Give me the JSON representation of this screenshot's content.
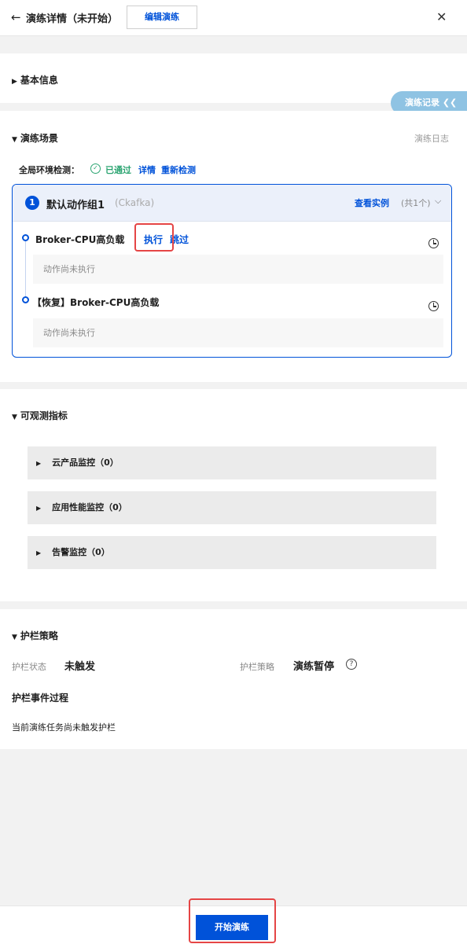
{
  "header": {
    "back_icon": "arrow-left-icon",
    "title": "演练详情（未开始）",
    "edit_label": "编辑演练",
    "close_icon": "close-icon"
  },
  "basic_info": {
    "title": "基本信息"
  },
  "record_tab": {
    "label": "演练记录 ❮❮"
  },
  "scene": {
    "title": "演练场景",
    "log_link": "演练日志",
    "env_check_label": "全局环境检测：",
    "env_check_status": "已通过",
    "env_check_detail": "详情",
    "env_check_recheck": "重新检测",
    "group": {
      "index": "1",
      "name": "默认动作组1",
      "subtitle": "(Ckafka)",
      "view_instances": "查看实例",
      "instance_count": "(共1个)",
      "actions": [
        {
          "name": "Broker-CPU高负载",
          "execute_label": "执行",
          "skip_label": "跳过",
          "status": "动作尚未执行"
        },
        {
          "name": "【恢复】Broker-CPU高负载",
          "status": "动作尚未执行"
        }
      ]
    }
  },
  "metrics": {
    "title": "可观测指标",
    "rows": [
      {
        "label": "云产品监控（0）"
      },
      {
        "label": "应用性能监控（0）"
      },
      {
        "label": "告警监控（0）"
      }
    ]
  },
  "guard": {
    "title": "护栏策略",
    "status_key": "护栏状态",
    "status_value": "未触发",
    "policy_key": "护栏策略",
    "policy_value": "演练暂停",
    "events_title": "护栏事件过程",
    "events_empty": "当前演练任务尚未触发护栏"
  },
  "footer": {
    "start_label": "开始演练"
  },
  "colors": {
    "primary": "#0052d9",
    "success": "#2ba471",
    "highlight": "#e54545"
  }
}
